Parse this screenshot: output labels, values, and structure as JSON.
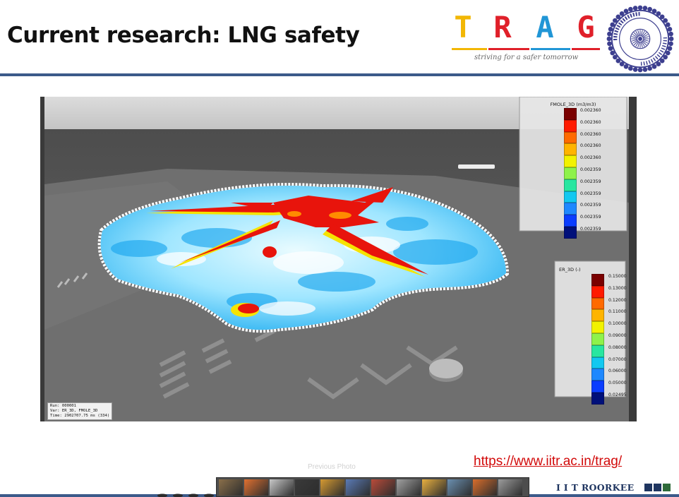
{
  "slide": {
    "title": "Current research: LNG safety",
    "website": "https://www.iitr.ac.in/trag/",
    "ghost_caption": "Previous Photo"
  },
  "brand": {
    "letters": [
      {
        "char": "T",
        "color": "#f2b705"
      },
      {
        "char": "R",
        "color": "#e0202a"
      },
      {
        "char": "A",
        "color": "#2196d6"
      },
      {
        "char": "G",
        "color": "#e0202a"
      }
    ],
    "bar_colors": [
      "#f2b705",
      "#e0202a",
      "#2196d6",
      "#e0202a"
    ],
    "tagline": "striving for a safer tomorrow",
    "seal_color": "#3d3f8f",
    "seal_icon": "iit-roorkee-seal-icon"
  },
  "simulation": {
    "legend_fmole": {
      "title": "FMOLE_3D (m3/m3)",
      "labels": [
        "0.002360",
        "0.002360",
        "0.002360",
        "0.002360",
        "0.002360",
        "0.002359",
        "0.002359",
        "0.002359",
        "0.002359",
        "0.002359",
        "0.002359"
      ],
      "colors": [
        "#7a0000",
        "#ff1a00",
        "#ff6a00",
        "#ffb400",
        "#f2f200",
        "#8ef24a",
        "#28e6a0",
        "#12c8f0",
        "#1e88ff",
        "#0a3dff",
        "#00107a"
      ]
    },
    "legend_er": {
      "title": "ER_3D (-)",
      "labels": [
        "0.15000",
        "0.13000",
        "0.12000",
        "0.11000",
        "0.10000",
        "0.09000",
        "0.08000",
        "0.07000",
        "0.06000",
        "0.05000",
        "0.02495"
      ],
      "colors": [
        "#7a0000",
        "#ff1a00",
        "#ff6a00",
        "#ffb400",
        "#f2f200",
        "#8ef24a",
        "#28e6a0",
        "#12c8f0",
        "#1e88ff",
        "#0a3dff",
        "#00107a"
      ]
    },
    "run_info": {
      "run": "Run: 000001",
      "var": "Var: ER_3D, FMOLE_3D",
      "time": "Time: 2902707.75 ms (334)"
    }
  },
  "footer": {
    "institute": "I I T ROORKEE",
    "square_colors": [
      "#1f3560",
      "#1f3560",
      "#2f6b3a"
    ],
    "thumbnail_colors": [
      "#8a6f4a",
      "#e07030",
      "#c8c8c8",
      "#3a3a3a",
      "#d59a32",
      "#5a7ab5",
      "#b94b3a",
      "#a0a0a0",
      "#e8b040",
      "#6a8fb0",
      "#d86d2c",
      "#9b9b9b"
    ]
  }
}
